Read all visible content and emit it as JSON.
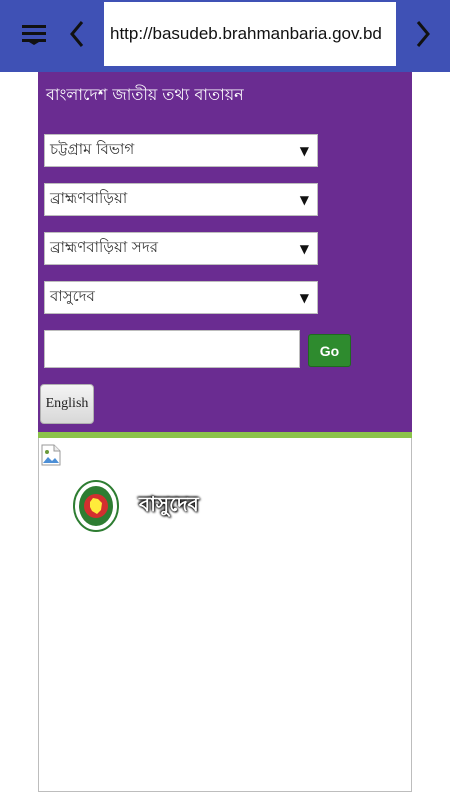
{
  "browser": {
    "url": "http://basudeb.brahmanbaria.gov.bd",
    "menu_icon": "menu-icon",
    "back_icon": "chevron-left-icon",
    "forward_icon": "chevron-right-icon"
  },
  "portal": {
    "title": "বাংলাদেশ জাতীয় তথ্য বাতায়ন",
    "selects": [
      {
        "value": "চট্টগ্রাম বিভাগ"
      },
      {
        "value": "ব্রাহ্মণবাড়িয়া"
      },
      {
        "value": "ব্রাহ্মণবাড়িয়া সদর"
      },
      {
        "value": "বাসুদেব"
      }
    ],
    "go_label": "Go",
    "english_label": "English"
  },
  "content": {
    "site_name": "বাসুদেব",
    "emblem_icon": "government-emblem-icon",
    "broken_image_icon": "broken-image-icon"
  },
  "colors": {
    "topbar": "#3f51b5",
    "portal_bg": "#6a2c91",
    "go_button": "#2e8b2e",
    "divider": "#8bc34a"
  }
}
